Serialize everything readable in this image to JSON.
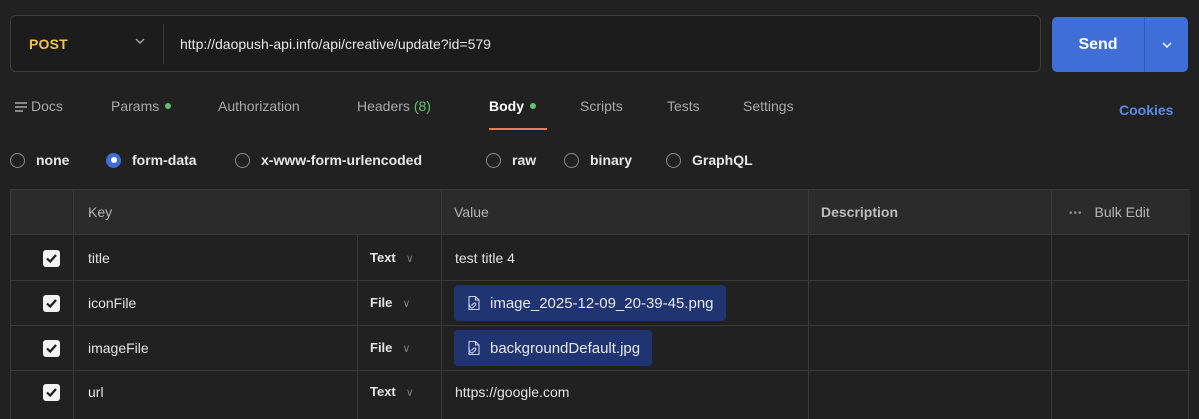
{
  "request": {
    "method": "POST",
    "url": "http://daopush-api.info/api/creative/update?id=579",
    "send_label": "Send"
  },
  "tabs": [
    {
      "label": "Docs",
      "icon": "docs-icon"
    },
    {
      "label": "Params",
      "has_dot": true
    },
    {
      "label": "Authorization"
    },
    {
      "label": "Headers",
      "count": "(8)"
    },
    {
      "label": "Body",
      "has_dot": true,
      "active": true
    },
    {
      "label": "Scripts"
    },
    {
      "label": "Tests"
    },
    {
      "label": "Settings"
    }
  ],
  "cookies_label": "Cookies",
  "body_types": [
    {
      "label": "none",
      "checked": false
    },
    {
      "label": "form-data",
      "checked": true
    },
    {
      "label": "x-www-form-urlencoded",
      "checked": false
    },
    {
      "label": "raw",
      "checked": false
    },
    {
      "label": "binary",
      "checked": false
    },
    {
      "label": "GraphQL",
      "checked": false
    }
  ],
  "table": {
    "headers": {
      "key": "Key",
      "value": "Value",
      "description": "Description",
      "bulk_edit": "Bulk Edit"
    },
    "rows": [
      {
        "checked": true,
        "key": "title",
        "type": "Text",
        "value": "test title 4",
        "is_file": false
      },
      {
        "checked": true,
        "key": "iconFile",
        "type": "File",
        "value": "image_2025-12-09_20-39-45.png",
        "is_file": true
      },
      {
        "checked": true,
        "key": "imageFile",
        "type": "File",
        "value": "backgroundDefault.jpg",
        "is_file": true
      },
      {
        "checked": true,
        "key": "url",
        "type": "Text",
        "value": "https://google.com",
        "is_file": false
      }
    ]
  },
  "colors": {
    "method": "#f0c44c",
    "send": "#3f6fd6",
    "active_tab_underline": "#ed7a4a",
    "status_dot": "#5fc46a",
    "file_chip": "#1f3470"
  }
}
